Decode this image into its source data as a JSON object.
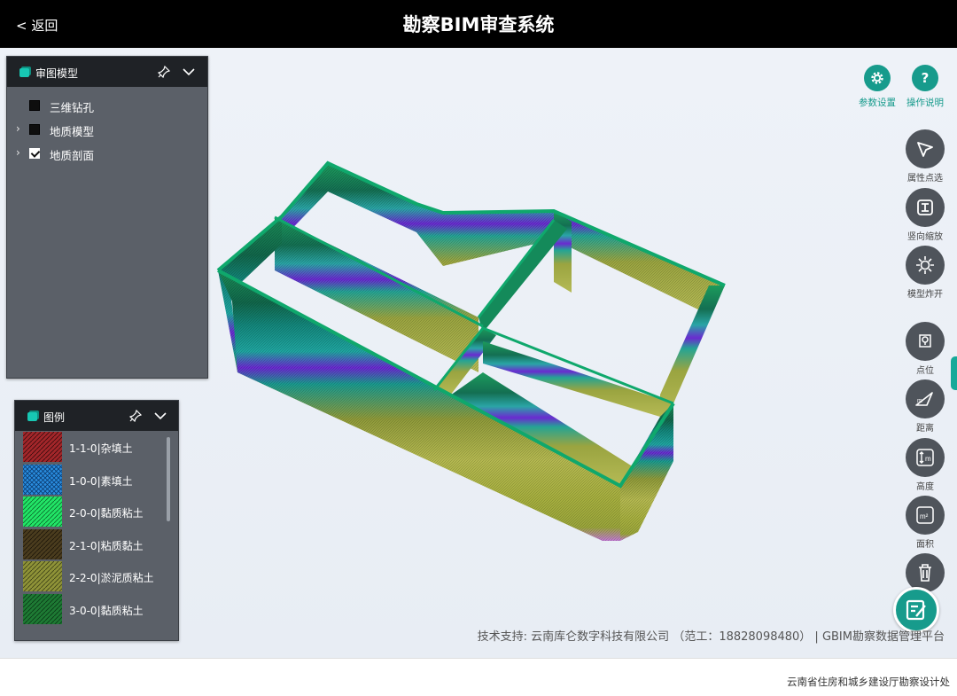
{
  "header": {
    "back_label": "< 返回",
    "title": "勘察BIM审查系统"
  },
  "model_panel": {
    "title": "审图模型",
    "items": [
      {
        "label": "三维钻孔",
        "checked": false,
        "expandable": false
      },
      {
        "label": "地质模型",
        "checked": false,
        "expandable": true
      },
      {
        "label": "地质剖面",
        "checked": true,
        "expandable": true
      }
    ]
  },
  "legend_panel": {
    "title": "图例",
    "items": [
      {
        "label": "1-1-0|杂填土",
        "color": "#a3262a",
        "hatch": "#3a0c0e"
      },
      {
        "label": "1-0-0|素填土",
        "color": "#2a8ee0",
        "hatch": "#0b3d73"
      },
      {
        "label": "2-0-0|黏质粘土",
        "color": "#22e567",
        "hatch": "#0a6b2c"
      },
      {
        "label": "2-1-0|粘质黏土",
        "color": "#4a3c1e",
        "hatch": "#1d160a"
      },
      {
        "label": "2-2-0|淤泥质粘土",
        "color": "#8f9338",
        "hatch": "#3f4218"
      },
      {
        "label": "3-0-0|黏质粘土",
        "color": "#1e7a34",
        "hatch": "#0a3a17"
      }
    ]
  },
  "toolbar": {
    "settings_label": "参数设置",
    "help_label": "操作说明",
    "help_glyph": "?",
    "tools": [
      {
        "name": "attribute-select",
        "label": "属性点选",
        "icon": "cursor-arrow-icon"
      },
      {
        "name": "vertical-scale",
        "label": "竖向缩放",
        "icon": "vertical-scale-icon"
      },
      {
        "name": "model-explode",
        "label": "模型炸开",
        "icon": "explode-icon"
      },
      {
        "name": "point",
        "label": "点位",
        "icon": "map-pin-icon"
      },
      {
        "name": "distance",
        "label": "距离",
        "icon": "distance-icon",
        "glyph": "m"
      },
      {
        "name": "height",
        "label": "高度",
        "icon": "height-icon",
        "glyph": "m"
      },
      {
        "name": "area",
        "label": "面积",
        "icon": "area-icon",
        "glyph": "m²"
      },
      {
        "name": "delete",
        "label": "",
        "icon": "trash-icon"
      }
    ]
  },
  "support_text": "技术支持: 云南库仑数字科技有限公司 （范工：18828098480） | GBIM勘察数据管理平台",
  "footer_text": "云南省住房和城乡建设厅勘察设计处",
  "colors": {
    "accent": "#179b8c",
    "header_bg": "#000000",
    "panel_bg": "#5b6068",
    "panel_head": "#1f2226"
  }
}
